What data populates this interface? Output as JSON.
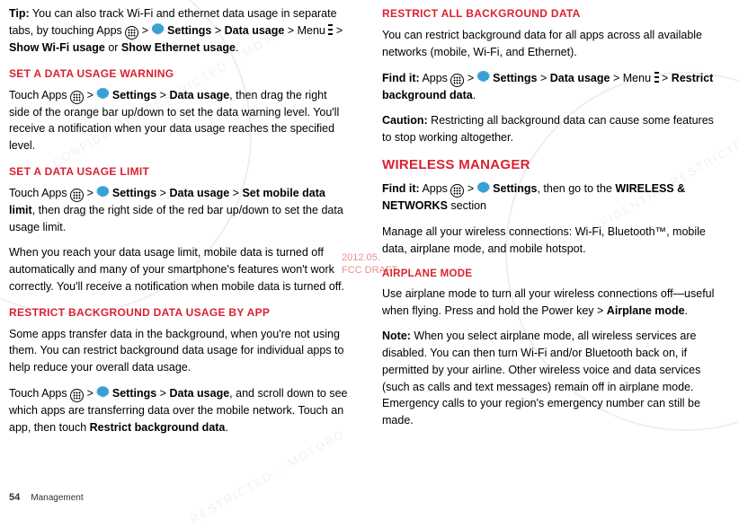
{
  "draft": {
    "date": "2012.05.",
    "label": "FCC DRAFT"
  },
  "left": {
    "tip_label": "Tip:",
    "tip_text_1": " You can also track Wi-Fi and ethernet data usage in separate tabs, by touching Apps ",
    "gt": ">",
    "settings_label": "Settings",
    "data_usage_label": "Data usage",
    "menu_label": "Menu",
    "show_wifi": "Show Wi-Fi usage",
    "or": " or ",
    "show_eth": "Show Ethernet usage",
    "period": ".",
    "h_warning": "SET A DATA USAGE WARNING",
    "warning_p1a": "Touch Apps ",
    "warning_p1b": ", then drag the right side of the orange bar up/down to set the data warning level. You'll receive a notification when your data usage reaches the specified level.",
    "h_limit": "SET A DATA USAGE LIMIT",
    "limit_p1a": "Touch Apps ",
    "set_mobile": "Set mobile data limit",
    "limit_p1b": ", then drag the right side of the red bar up/down to set the data usage limit.",
    "limit_p2": "When you reach your data usage limit, mobile data is turned off automatically and many of your smartphone's features won't work correctly. You'll receive a notification when mobile data is turned off.",
    "h_restrict_app": "RESTRICT BACKGROUND DATA USAGE BY APP",
    "restrict_p1": "Some apps transfer data in the background, when you're not using them. You can restrict background data usage for individual apps to help reduce your overall data usage.",
    "restrict_p2a": "Touch Apps ",
    "restrict_p2b": ", and scroll down to see which apps are transferring data over the mobile network. Touch an app, then touch ",
    "restrict_bg": "Restrict background data"
  },
  "right": {
    "h_restrict_all": "RESTRICT ALL BACKGROUND DATA",
    "restrict_all_p1": "You can restrict background data for all apps across all available networks (mobile, Wi-Fi, and Ethernet).",
    "find_it": "Find it:",
    "apps_word": " Apps ",
    "caution_label": "Caution:",
    "caution_text": " Restricting all background data can cause some features to stop working altogether.",
    "h_wireless": "WIRELESS MANAGER",
    "wm_findit_b": ", then go to the ",
    "wireless_networks": "WIRELESS & NETWORKS",
    "section": " section",
    "wm_p2": "Manage all your wireless connections: Wi-Fi, Bluetooth™, mobile data, airplane mode, and mobile hotspot.",
    "h_airplane": "AIRPLANE MODE",
    "air_p1": "Use airplane mode to turn all your wireless connections off—useful when flying. Press and hold the Power key > ",
    "airplane_mode": "Airplane mode",
    "note_label": "Note:",
    "note_text": " When you select airplane mode, all wireless services are disabled. You can then turn Wi-Fi and/or Bluetooth back on, if permitted by your airline. Other wireless voice and data services (such as calls and text messages) remain off in airplane mode. Emergency calls to your region's emergency number can still be made."
  },
  "footer": {
    "page": "54",
    "section": "Management"
  }
}
